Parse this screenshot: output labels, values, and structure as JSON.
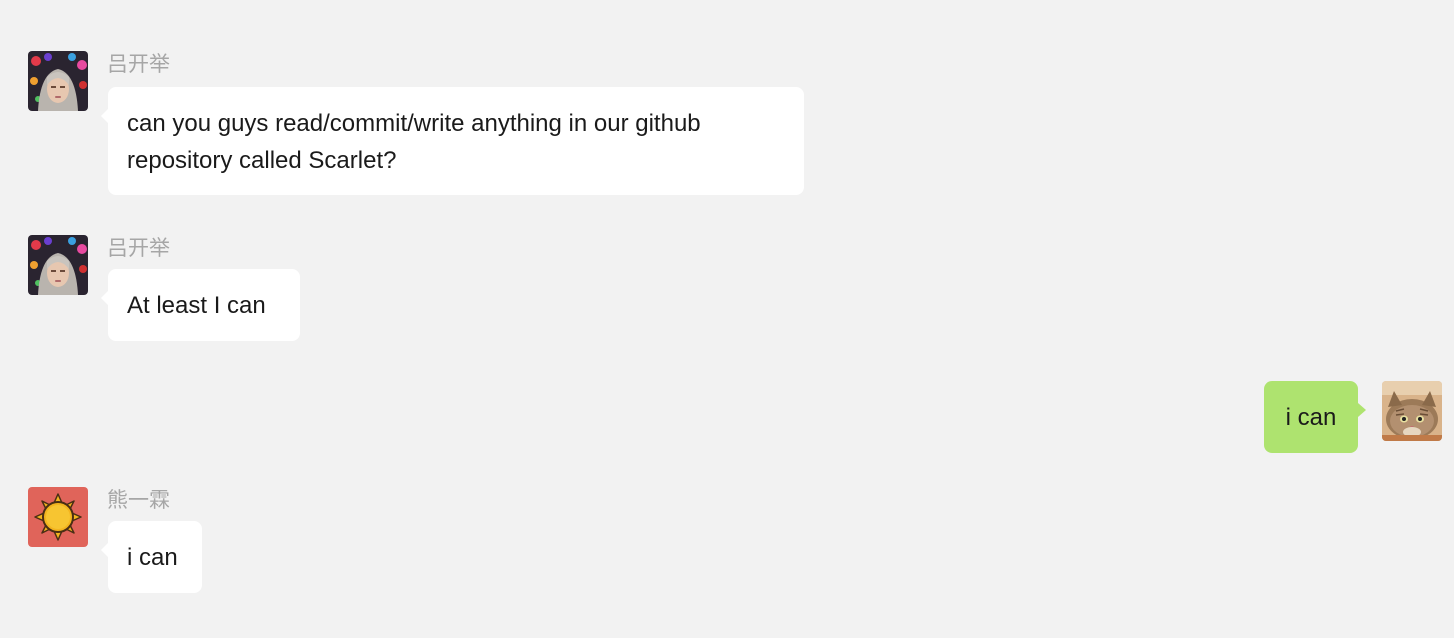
{
  "messages": [
    {
      "sender": "吕开举",
      "text": "can you guys read/commit/write anything in our github repository called Scarlet?",
      "side": "left",
      "avatar": "girl-photo-avatar"
    },
    {
      "sender": "吕开举",
      "text": "At least I can",
      "side": "left",
      "avatar": "girl-photo-avatar"
    },
    {
      "sender": "",
      "text": "i can",
      "side": "right",
      "avatar": "cat-photo-avatar"
    },
    {
      "sender": "熊一霖",
      "text": "i can",
      "side": "left",
      "avatar": "sun-icon-avatar"
    }
  ],
  "colors": {
    "background": "#f2f2f2",
    "incoming_bubble": "#ffffff",
    "outgoing_bubble": "#aee36f",
    "sender_name": "#a6a6a6",
    "sun_avatar_bg": "#e0645a"
  }
}
